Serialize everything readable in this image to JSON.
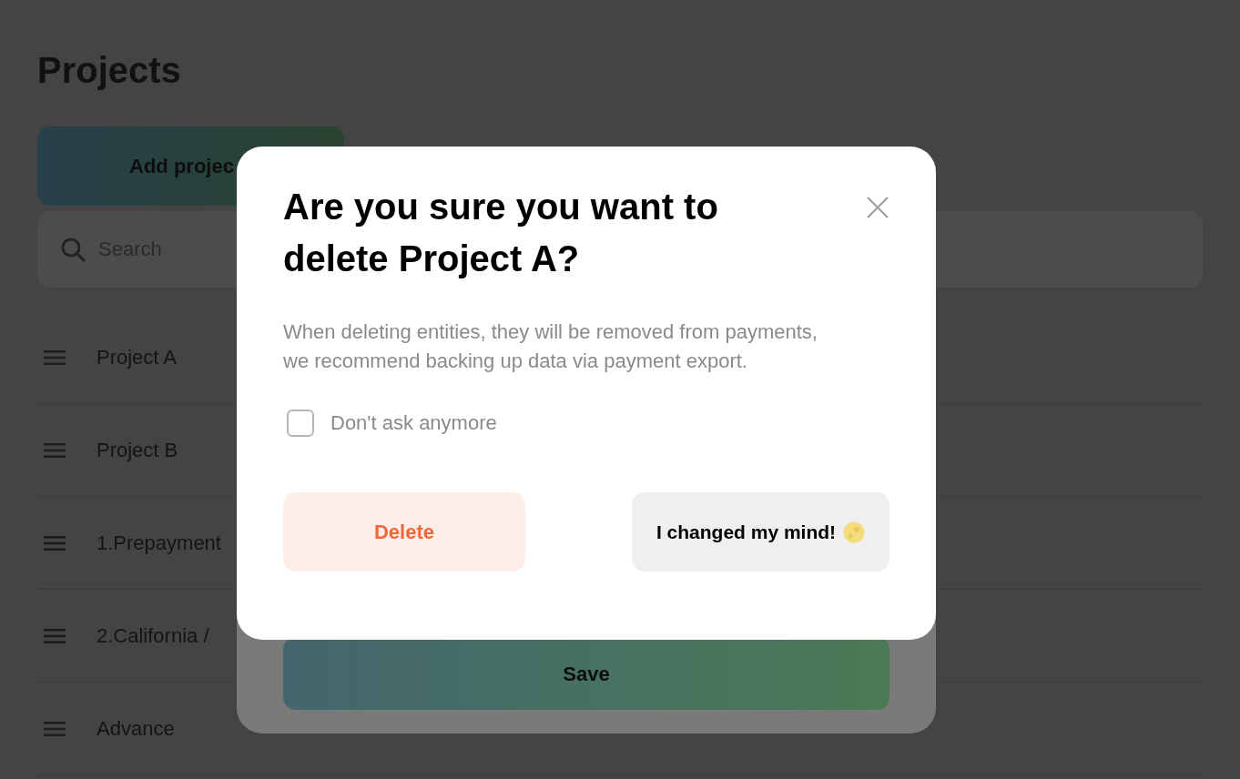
{
  "page": {
    "title": "Projects",
    "add_button": "Add projec",
    "search": {
      "placeholder": "Search"
    },
    "projects": [
      {
        "name": "Project A"
      },
      {
        "name": "Project B"
      },
      {
        "name": "1.Prepayment"
      },
      {
        "name": "2.California /"
      },
      {
        "name": "Advance"
      }
    ]
  },
  "back_dialog": {
    "save_button": "Save"
  },
  "dialog": {
    "title": "Are you sure you want to delete Project A?",
    "message": "When deleting entities, they will be removed from payments, we recommend backing up data via payment export.",
    "checkbox": {
      "label": "Don't ask anymore",
      "checked": false
    },
    "delete_button": "Delete",
    "cancel_button": "I changed my mind!"
  }
}
